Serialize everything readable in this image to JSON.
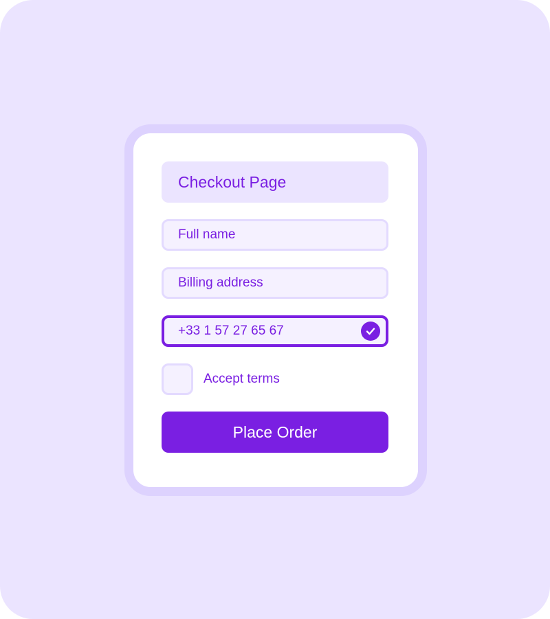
{
  "colors": {
    "background": "#ebe4ff",
    "card_border": "#ddd2fe",
    "accent": "#7a1fe2",
    "field_fill": "#f5f1ff",
    "field_border": "#e3daff"
  },
  "form": {
    "title": "Checkout Page",
    "fields": {
      "full_name": {
        "placeholder": "Full name",
        "value": ""
      },
      "billing_address": {
        "placeholder": "Billing address",
        "value": ""
      },
      "phone": {
        "value": "+33 1 57 27 65 67",
        "status_icon": "check-circle-icon"
      }
    },
    "terms": {
      "label": "Accept terms",
      "checked": false
    },
    "submit_label": "Place Order"
  }
}
